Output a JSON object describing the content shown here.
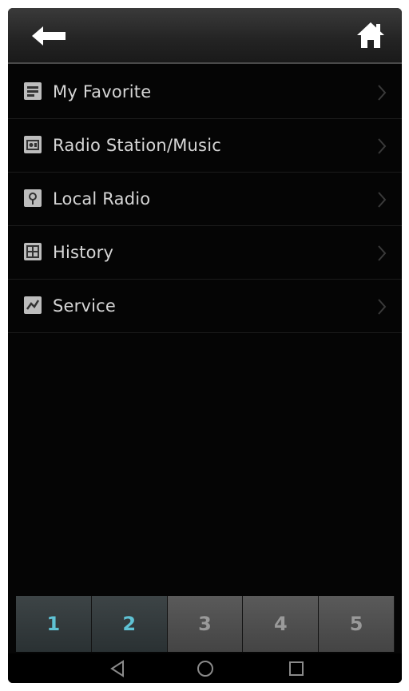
{
  "header": {
    "back_icon": "back-arrow-icon",
    "home_icon": "home-icon"
  },
  "menu": {
    "items": [
      {
        "label": "My Favorite",
        "icon": "favorite-icon"
      },
      {
        "label": "Radio Station/Music",
        "icon": "radio-station-icon"
      },
      {
        "label": "Local Radio",
        "icon": "local-radio-icon"
      },
      {
        "label": "History",
        "icon": "history-icon"
      },
      {
        "label": "Service",
        "icon": "service-icon"
      }
    ]
  },
  "presets": {
    "tabs": [
      {
        "label": "1"
      },
      {
        "label": "2"
      },
      {
        "label": "3"
      },
      {
        "label": "4"
      },
      {
        "label": "5"
      }
    ]
  },
  "navigation": {
    "back_icon": "nav-back-icon",
    "home_icon": "nav-home-icon",
    "recents_icon": "nav-recents-icon"
  },
  "colors": {
    "background": "#050505",
    "header": "#2a2a2a",
    "text": "#d6d6d6",
    "active_preset": "#5fc2d4"
  }
}
